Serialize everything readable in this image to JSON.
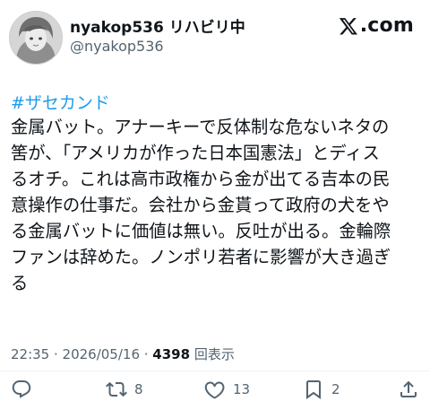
{
  "author": {
    "display_name": "nyakop536 リハビリ中",
    "handle": "@nyakop536"
  },
  "brand": {
    "text": ".com",
    "icon": "x-logo-icon"
  },
  "post": {
    "hashtag": "#ザセカンド",
    "lines": [
      "金属バット。アナーキーで反体制な危ないネタの",
      "筈が、「アメリカが作った日本国憲法」とディス",
      "るオチ。これは高市政権から金が出てる吉本の民",
      "意操作の仕事だ。会社から金貰って政府の犬をや",
      "る金属バットに価値は無い。反吐が出る。金輪際",
      "ファンは辞めた。ノンポリ若者に影響が大き過ぎ",
      "る"
    ]
  },
  "meta": {
    "timestamp": "22:35 · 2026/05/16 · ",
    "views_count": "4398",
    "views_label": " 回表示"
  },
  "actions": {
    "reply": {
      "icon": "reply-icon"
    },
    "repost": {
      "icon": "repost-icon",
      "count": "8"
    },
    "like": {
      "icon": "heart-icon",
      "count": "13"
    },
    "bookmark": {
      "icon": "bookmark-icon",
      "count": "2"
    },
    "share": {
      "icon": "share-icon"
    }
  },
  "colors": {
    "text": "#0f1419",
    "secondary": "#536471",
    "hashtag": "#1d9bf0",
    "divider": "#eff3f4"
  }
}
